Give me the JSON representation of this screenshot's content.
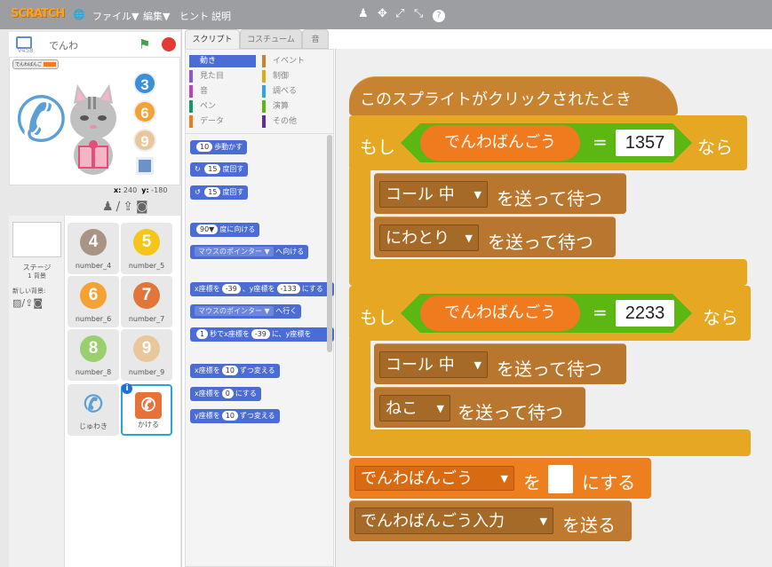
{
  "app": {
    "logo": "SCRATCH",
    "menu": [
      "ファイル▼",
      "編集▼",
      "ヒント",
      "説明"
    ],
    "tools": [
      "♟",
      "✥",
      "⤢",
      "⤡",
      "?"
    ]
  },
  "stage": {
    "sprite_name": "でんわ",
    "version": "v458",
    "variable_label": "でんわばんご",
    "numbers": [
      "3",
      "6",
      "9"
    ],
    "coord_x_label": "x:",
    "coord_x": "240",
    "coord_y_label": "y:",
    "coord_y": "-180"
  },
  "sprites": {
    "stage_label": "ステージ",
    "stage_bg_count": "1 背景",
    "new_bg_label": "新しい背景:",
    "items": [
      {
        "name": "number_4",
        "glyph": "4",
        "color": "#a89384"
      },
      {
        "name": "number_5",
        "glyph": "5",
        "color": "#f5c518"
      },
      {
        "name": "number_6",
        "glyph": "6",
        "color": "#f5a234"
      },
      {
        "name": "number_7",
        "glyph": "7",
        "color": "#e0763a"
      },
      {
        "name": "number_8",
        "glyph": "8",
        "color": "#9ad06b"
      },
      {
        "name": "number_9",
        "glyph": "9",
        "color": "#e8c89a"
      },
      {
        "name": "じゅわき",
        "glyph": "📞",
        "color": "#5b9fd9"
      },
      {
        "name": "かける",
        "glyph": "✆",
        "color": "#e8713a"
      }
    ]
  },
  "tabs": [
    "スクリプト",
    "コスチューム",
    "音"
  ],
  "palette": {
    "categories_left": [
      "動き",
      "見た目",
      "音",
      "ペン",
      "データ"
    ],
    "categories_right": [
      "イベント",
      "制御",
      "調べる",
      "演算",
      "その他"
    ],
    "blocks": {
      "move_num": "10",
      "move_label": "歩動かす",
      "rot_cw_num": "15",
      "rot_cw_label": "度回す",
      "rot_ccw_num": "15",
      "rot_ccw_label": "度回す",
      "point_num": "90▼",
      "point_label": "度に向ける",
      "point_toward_dd": "マウスのポインター ▼",
      "point_toward_label": "へ向ける",
      "goto_xy_a": "x座標を",
      "goto_x": "-39",
      "goto_xy_b": "、y座標を",
      "goto_y": "-133",
      "goto_xy_c": "にする",
      "goto_dd": "マウスのポインター ▼",
      "goto_label": "へ行く",
      "glide_num": "1",
      "glide_a": "秒でx座標を",
      "glide_x": "-39",
      "glide_b": "に、y座標を",
      "change_x_a": "x座標を",
      "change_x_num": "10",
      "change_x_b": "ずつ変える",
      "set_x_a": "x座標を",
      "set_x_num": "0",
      "set_x_b": "にする",
      "change_y_a": "y座標を",
      "change_y_num": "10",
      "change_y_b": "ずつ変える"
    }
  },
  "script": {
    "hat_label": "このスプライトがクリックされたとき",
    "if1": {
      "if_label": "もし",
      "var": "でんわばんごう",
      "eq": "=",
      "value": "1357",
      "then": "なら"
    },
    "if1_body": [
      {
        "dd": "コール 中",
        "label": "を送って待つ"
      },
      {
        "dd": "にわとり",
        "label": "を送って待つ"
      }
    ],
    "if2": {
      "if_label": "もし",
      "var": "でんわばんごう",
      "eq": "=",
      "value": "2233",
      "then": "なら"
    },
    "if2_body": [
      {
        "dd": "コール 中",
        "label": "を送って待つ"
      },
      {
        "dd": "ねこ",
        "label": "を送って待つ"
      }
    ],
    "set_var": {
      "dd": "でんわばんごう",
      "a": "を",
      "value": "",
      "b": "にする"
    },
    "broadcast": {
      "dd": "でんわばんごう入力",
      "label": "を送る"
    }
  }
}
